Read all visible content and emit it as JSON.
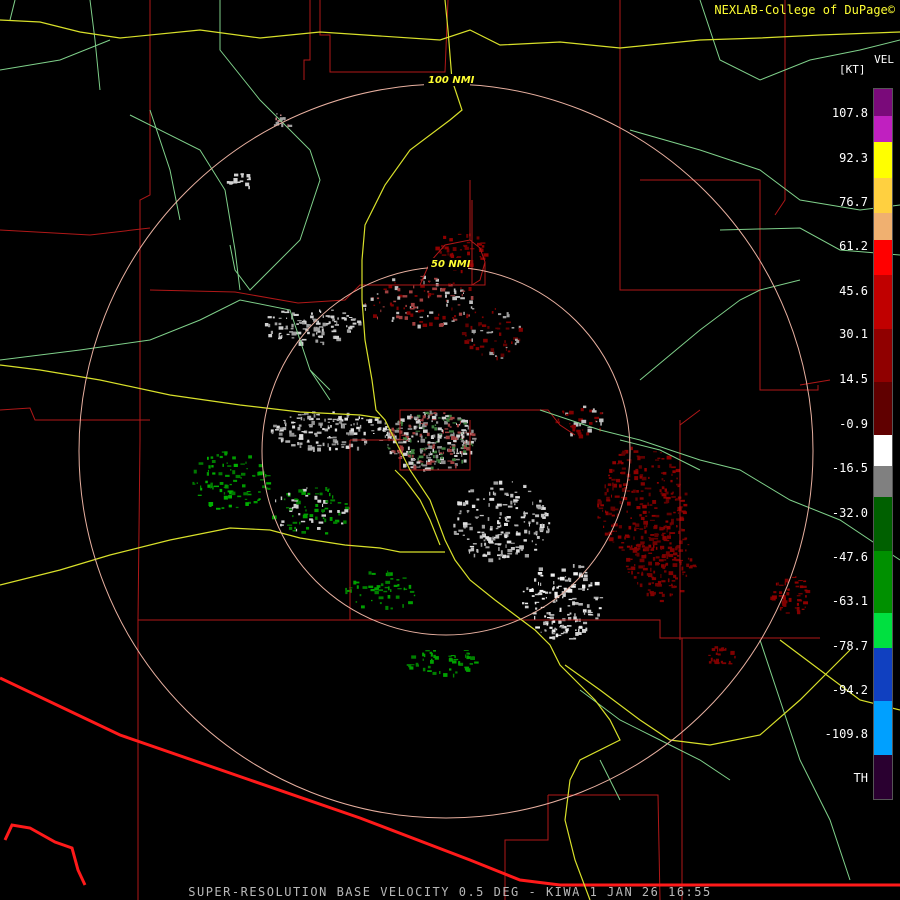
{
  "credit": "NEXLAB-College of DuPage©",
  "footer": "SUPER-RESOLUTION BASE VELOCITY 0.5 DEG - KIWA 1 JAN 26 16:55",
  "legend": {
    "product": "VEL",
    "unit": "[KT]",
    "ticks": [
      "107.8",
      "92.3",
      "76.7",
      "61.2",
      "45.6",
      "30.1",
      "14.5",
      "-0.9",
      "-16.5",
      "-32.0",
      "-47.6",
      "-63.1",
      "-78.7",
      "-94.2",
      "-109.8",
      "TH"
    ],
    "segments": [
      {
        "color": "#7a0a7a"
      },
      {
        "color": "#c020c0"
      },
      {
        "color": "#ffff00"
      },
      {
        "color": "#ffd040"
      },
      {
        "color": "#f0b070"
      },
      {
        "color": "#ff0000"
      },
      {
        "color": "#c00000"
      },
      {
        "color": "#900000"
      },
      {
        "color": "#600000"
      },
      {
        "color": "#ffffff"
      },
      {
        "color": "#808080"
      },
      {
        "color": "#006000"
      },
      {
        "color": "#009000"
      },
      {
        "color": "#00e040"
      },
      {
        "color": "#1040c0"
      },
      {
        "color": "#00a0ff"
      },
      {
        "color": "#2a0030"
      }
    ]
  },
  "rings": [
    {
      "label": "100 NMI"
    },
    {
      "label": "50 NMI"
    }
  ],
  "colors": {
    "state_border": "#ff1a1a",
    "county_border": "#b01818",
    "highway": "#d8e02a",
    "road": "#7fd08a",
    "range_ring": "#e8b0a0",
    "inbound": "#00a000",
    "outbound": "#800000",
    "near_zero": "#d0d0d0"
  }
}
